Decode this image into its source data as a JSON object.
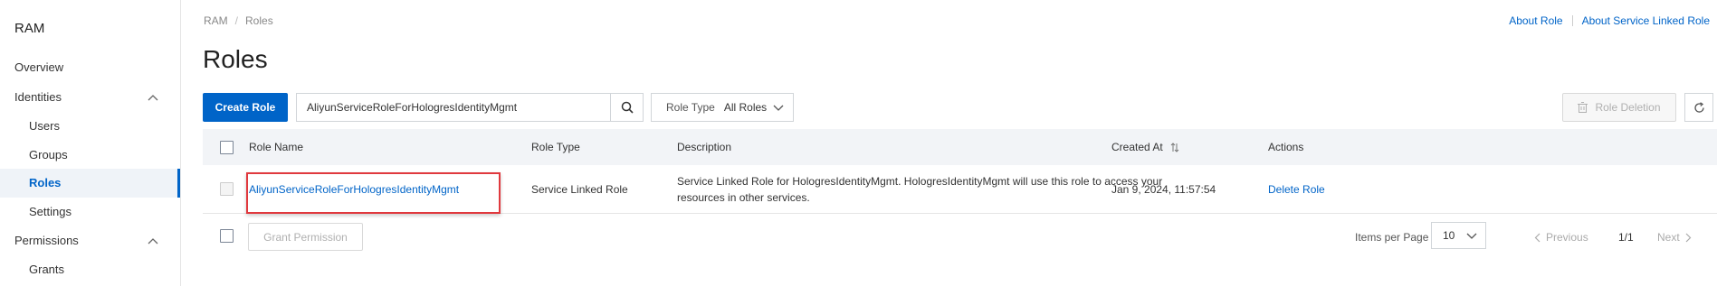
{
  "sidebar": {
    "title": "RAM",
    "items": [
      {
        "label": "Overview"
      },
      {
        "label": "Identities"
      },
      {
        "label": "Users"
      },
      {
        "label": "Groups"
      },
      {
        "label": "Roles"
      },
      {
        "label": "Settings"
      },
      {
        "label": "Permissions"
      },
      {
        "label": "Grants"
      }
    ]
  },
  "breadcrumb": {
    "root": "RAM",
    "separator": "/",
    "current": "Roles"
  },
  "top_links": {
    "about_role": "About Role",
    "about_slr": "About Service Linked Role"
  },
  "page_title": "Roles",
  "toolbar": {
    "create_role": "Create Role",
    "search_value": "AliyunServiceRoleForHologresIdentityMgmt",
    "role_type_label": "Role Type",
    "role_type_value": "All Roles",
    "role_deletion": "Role Deletion"
  },
  "table": {
    "headers": {
      "role_name": "Role Name",
      "role_type": "Role Type",
      "description": "Description",
      "created_at": "Created At",
      "actions": "Actions"
    },
    "rows": [
      {
        "role_name": "AliyunServiceRoleForHologresIdentityMgmt",
        "role_type": "Service Linked Role",
        "description": "Service Linked Role for HologresIdentityMgmt. HologresIdentityMgmt will use this role to access your resources in other services.",
        "created_at": "Jan 9, 2024, 11:57:54",
        "action": "Delete Role"
      }
    ]
  },
  "footer": {
    "grant_permission": "Grant Permission",
    "items_per_page_label": "Items per Page",
    "items_per_page_value": "10",
    "previous": "Previous",
    "page": "1/1",
    "next": "Next"
  },
  "colors": {
    "primary": "#0064c8",
    "highlight": "#e0393e"
  }
}
